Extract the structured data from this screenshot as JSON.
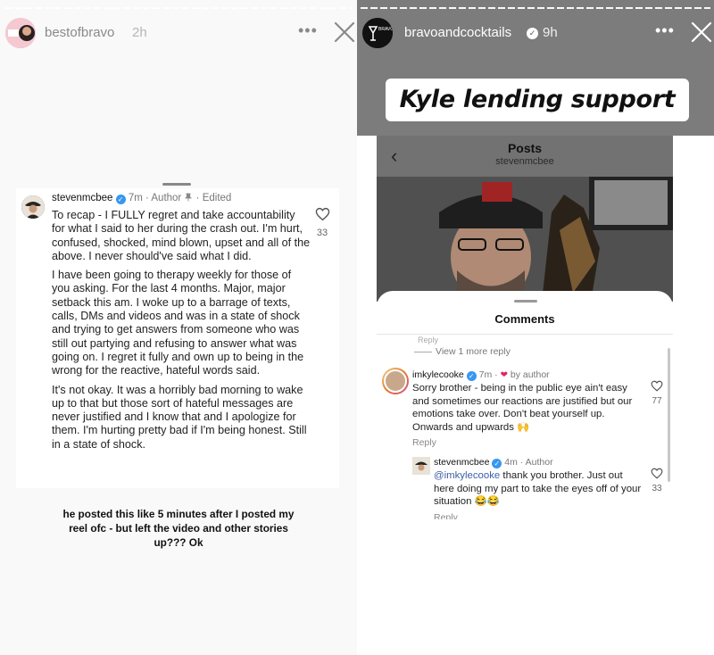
{
  "left_story": {
    "username": "bestofbravo",
    "time": "2h",
    "avatar_text": "Bravo",
    "comment": {
      "username": "stevenmcbee",
      "meta": "7m · Author",
      "edited": "· Edited",
      "paragraphs": [
        "To recap - I FULLY regret and take accountability for what I said to her during the crash out. I'm hurt, confused, shocked, mind blown, upset and all of the above. I never should've said what I did.",
        "I have been going to therapy weekly for those of you asking. For the last 4 months. Major, major setback this am. I woke up to a barrage of texts, calls, DMs and videos and was in a state of shock and trying to get answers from someone who was still out partying and refusing to answer what was going on. I regret it fully and own up to being in the wrong for the reactive, hateful words said.",
        "It's not okay. It was a horribly bad morning to wake up to that but those sort of hateful messages are never justified and I know that and I apologize for them. I'm hurting pretty bad if I'm being honest. Still in a state of shock."
      ],
      "likes": "33"
    },
    "caption": "he posted this like 5 minutes after I posted my reel ofc - but left the video and other stories up??? Ok"
  },
  "right_story": {
    "username": "bravoandcocktails",
    "time": "9h",
    "headline": "Kyle lending support",
    "screenshot": {
      "title": "Posts",
      "subtitle": "stevenmcbee",
      "sheet_title": "Comments",
      "reply_stub": "Reply",
      "view_more": "View 1 more reply",
      "comment1": {
        "username": "imkylecooke",
        "time": "7m",
        "by_author": "by author",
        "text": "Sorry brother - being in the public eye ain't easy and sometimes our reactions are justified but our emotions take over. Don't beat yourself up. Onwards and upwards 🙌",
        "likes": "77",
        "reply": "Reply"
      },
      "comment2": {
        "username": "stevenmcbee",
        "meta": "4m · Author",
        "mention": "@imkylecooke",
        "text": " thank you brother. Just out here doing my part to take the eyes off of your situation 😂😂",
        "likes": "33",
        "reply": "Reply"
      }
    }
  },
  "colors": {
    "verified": "#3897f0",
    "like_heart": "#e0245e",
    "mention": "#3c5ea8",
    "headline_bg": "#ffffff"
  },
  "icons": [
    "more-icon",
    "close-icon",
    "heart-icon",
    "back-chevron-icon",
    "verified-icon",
    "pin-icon"
  ]
}
